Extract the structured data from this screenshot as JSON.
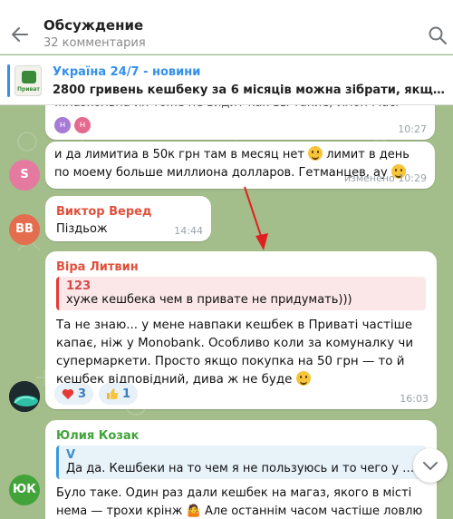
{
  "header": {
    "title": "Обсуждение",
    "subtitle": "32 комментария"
  },
  "pinned": {
    "channel": "Україна 24/7 - новини",
    "text": "2800 гривень кешбеку за 6 місяців можна зібрати, якщо активно ...",
    "thumb_label": "Приват"
  },
  "messages": {
    "m1": {
      "text": "...лазкольна их тоже не видит как вы такие, Илон Маск (",
      "time": "10:27",
      "reactions": [
        "н",
        "н"
      ]
    },
    "m2": {
      "avatar": "S",
      "text_1": "и да лимитиа в 50к грн там в месяц нет",
      "text_2": "лимит в день по моему больше миллиона долларов. Гетманцев, ау",
      "meta": "изменено 10:29"
    },
    "m3": {
      "avatar": "BB",
      "author": "Виктор Веред",
      "text": "Піздьож",
      "time": "14:44"
    },
    "m4": {
      "author": "Віра Литвин",
      "reply_author": "123",
      "reply_text": "хуже кешбека чем в привате не придумать)))",
      "text": "Та не знаю... у мене навпаки кешбек в Приваті частіше капає, ніж у Monobank. Особливо коли за комуналку чи супермаркети. Просто якщо покупка на 50 грн — то й кешбек відповідний, дива ж не буде",
      "reaction_heart": "3",
      "reaction_thumb": "1",
      "time": "16:03"
    },
    "m5": {
      "avatar": "ЮК",
      "author": "Юлия Козак",
      "reply_author": "V",
      "reply_text": "Да да. Кешбеки на то чем я не пользуюсь и то чего у меня в...",
      "text": "Було таке. Один раз дали кешбек на магаз, якого в місті нема — трохи крінж 🤷 Але останнім часом частіше ловлю на заправки,"
    }
  },
  "colors": {
    "accent": "#3390ec",
    "author_red": "#e0503c",
    "author_green": "#41a33a",
    "arrow": "#e02020"
  }
}
